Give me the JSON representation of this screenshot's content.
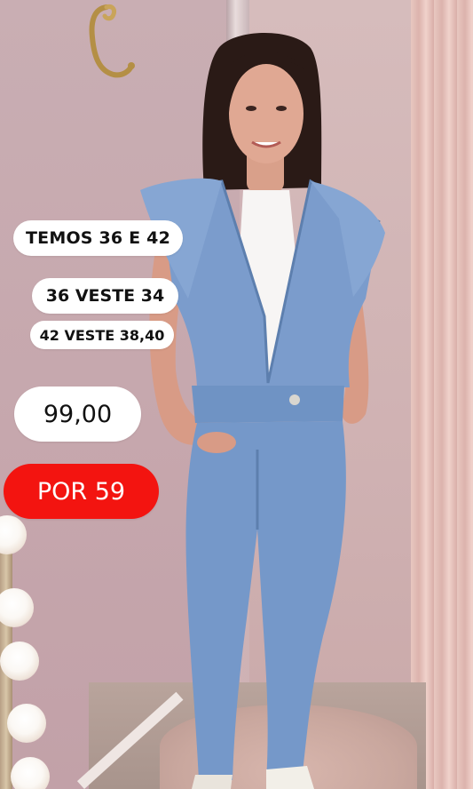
{
  "story": {
    "stickers": {
      "sizes_available": "TEMOS 36 E 42",
      "size_36_fit": "36 VESTE 34",
      "size_42_fit": "42 VESTE 38,40",
      "old_price": "99,00",
      "new_price": "POR 59"
    },
    "colors": {
      "sticker_bg": "#ffffff",
      "sticker_text": "#111111",
      "price_highlight": "#f31410",
      "wall": "#c9aeb3",
      "denim": "#6f93c4"
    },
    "photo": {
      "subject": "woman-wearing-denim-jumpsuit",
      "decor": [
        "gold-hook-icon",
        "vanity-light-bulbs",
        "pink-curtain",
        "fluffy-rug"
      ]
    }
  }
}
